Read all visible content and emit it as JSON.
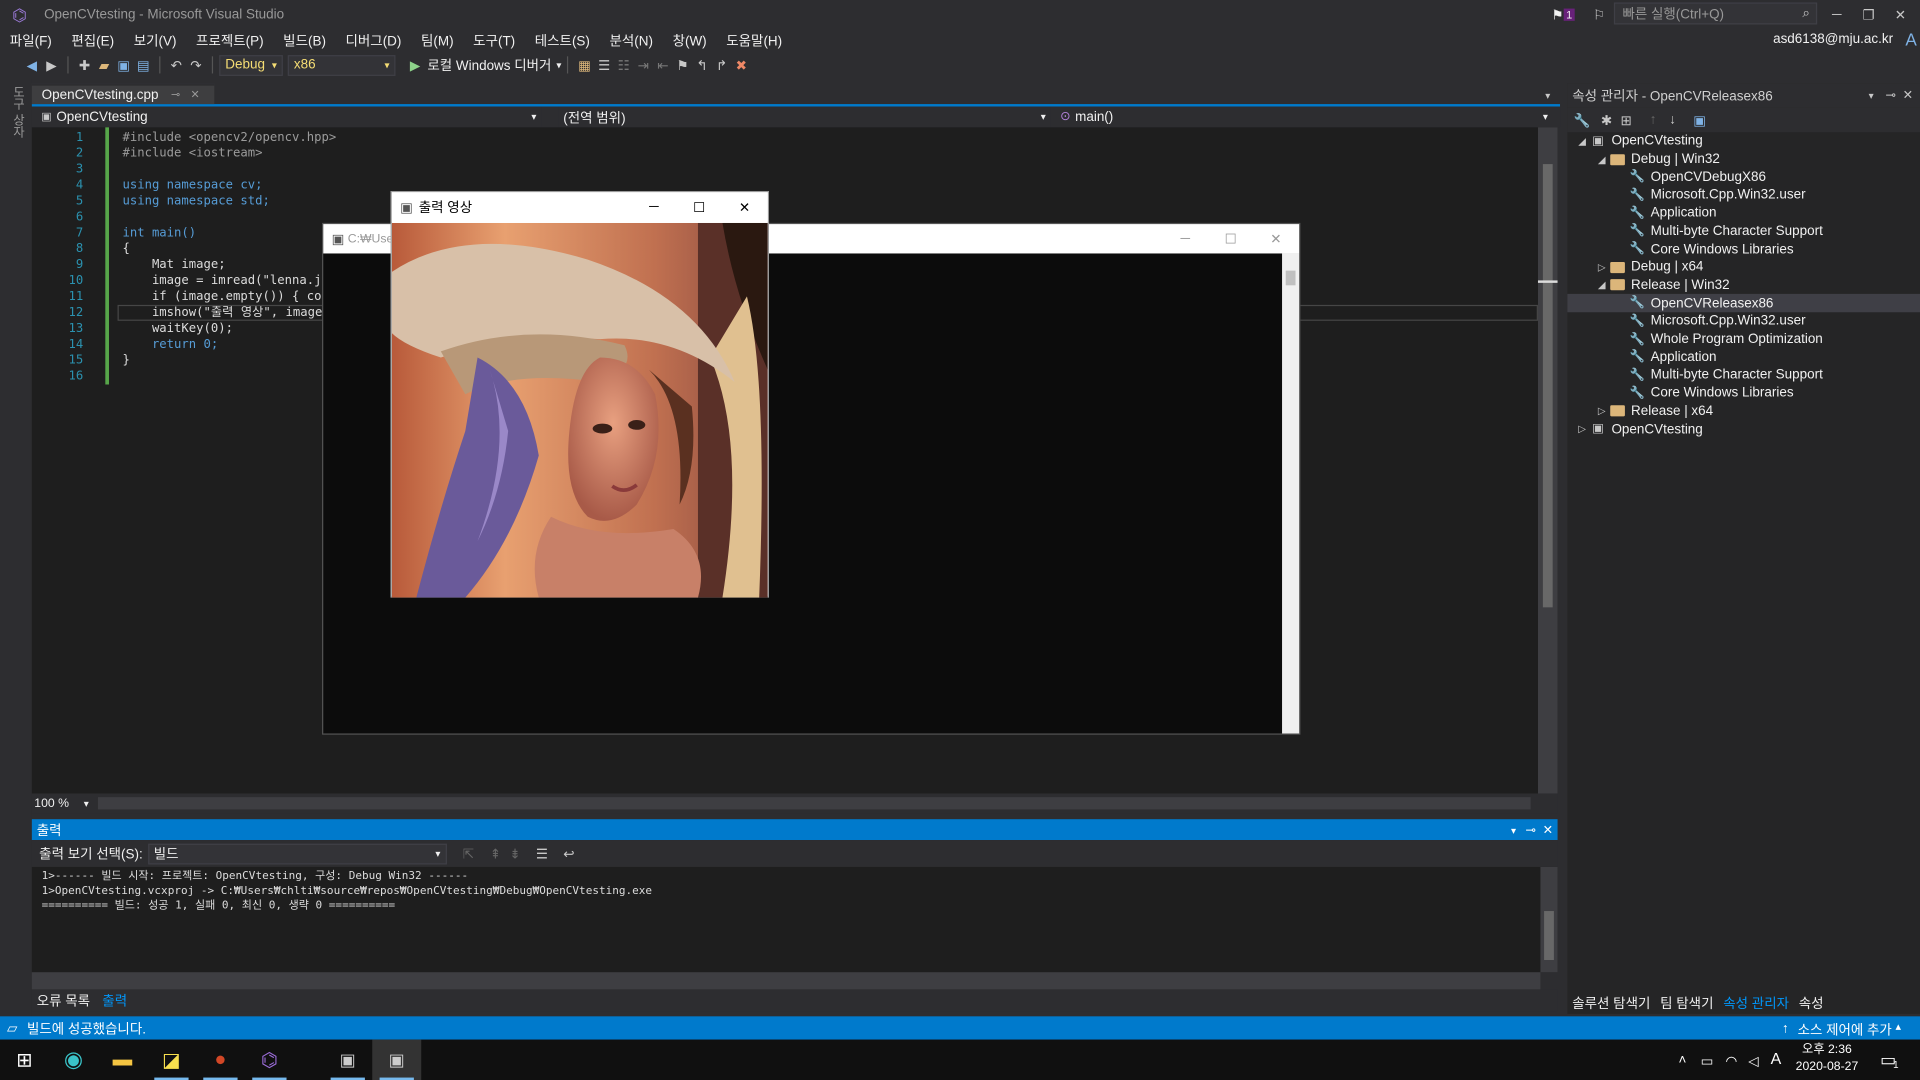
{
  "window_title": "OpenCVtesting - Microsoft Visual Studio",
  "search_placeholder": "빠른 실행(Ctrl+Q)",
  "notification_count": "1",
  "account": "asd6138@mju.ac.kr",
  "account_initial": "A",
  "menu": [
    "파일(F)",
    "편집(E)",
    "보기(V)",
    "프로젝트(P)",
    "빌드(B)",
    "디버그(D)",
    "팀(M)",
    "도구(T)",
    "테스트(S)",
    "분석(N)",
    "창(W)",
    "도움말(H)"
  ],
  "toolbar": {
    "config": "Debug",
    "platform": "x86",
    "debugger": "로컬 Windows 디버거"
  },
  "left_strip_label": "도구 상자",
  "doc_tab": "OpenCVtesting.cpp",
  "nav": {
    "project": "OpenCVtesting",
    "scope": "(전역 범위)",
    "member": "main()"
  },
  "code_lines": [
    "#include <opencv2/opencv.hpp>",
    "#include <iostream>",
    "",
    "using namespace cv;",
    "using namespace std;",
    "",
    "int main()",
    "{",
    "    Mat image;",
    "    image = imread(\"lenna.jpg",
    "    if (image.empty()) { cout",
    "    imshow(\"출력 영상\", image",
    "    waitKey(0);",
    "    return 0;",
    "}",
    ""
  ],
  "zoom": "100 %",
  "output": {
    "title": "출력",
    "source_label": "출력 보기 선택(S):",
    "source_value": "빌드",
    "lines": [
      "1>------ 빌드 시작: 프로젝트: OpenCVtesting, 구성: Debug Win32 ------",
      "1>OpenCVtesting.vcxproj -> C:₩Users₩chlti₩source₩repos₩OpenCVtesting₩Debug₩OpenCVtesting.exe",
      "========== 빌드: 성공 1, 실패 0, 최신 0, 생략 0 =========="
    ],
    "tabs": [
      "오류 목록",
      "출력"
    ]
  },
  "property_manager": {
    "title": "속성 관리자 - OpenCVReleasex86",
    "tree": [
      {
        "label": "OpenCVtesting",
        "level": 0,
        "kind": "project",
        "expanded": true
      },
      {
        "label": "Debug | Win32",
        "level": 1,
        "kind": "folder",
        "expanded": true
      },
      {
        "label": "OpenCVDebugX86",
        "level": 2,
        "kind": "sheet"
      },
      {
        "label": "Microsoft.Cpp.Win32.user",
        "level": 2,
        "kind": "sheet"
      },
      {
        "label": "Application",
        "level": 2,
        "kind": "sheet"
      },
      {
        "label": "Multi-byte Character Support",
        "level": 2,
        "kind": "sheet"
      },
      {
        "label": "Core Windows Libraries",
        "level": 2,
        "kind": "sheet"
      },
      {
        "label": "Debug | x64",
        "level": 1,
        "kind": "folder",
        "expanded": false
      },
      {
        "label": "Release | Win32",
        "level": 1,
        "kind": "folder",
        "expanded": true
      },
      {
        "label": "OpenCVReleasex86",
        "level": 2,
        "kind": "sheet",
        "selected": true
      },
      {
        "label": "Microsoft.Cpp.Win32.user",
        "level": 2,
        "kind": "sheet"
      },
      {
        "label": "Whole Program Optimization",
        "level": 2,
        "kind": "sheet"
      },
      {
        "label": "Application",
        "level": 2,
        "kind": "sheet"
      },
      {
        "label": "Multi-byte Character Support",
        "level": 2,
        "kind": "sheet"
      },
      {
        "label": "Core Windows Libraries",
        "level": 2,
        "kind": "sheet"
      },
      {
        "label": "Release | x64",
        "level": 1,
        "kind": "folder",
        "expanded": false
      },
      {
        "label": "OpenCVtesting",
        "level": 0,
        "kind": "project",
        "expanded": false
      }
    ],
    "tabs": [
      "솔루션 탐색기",
      "팀 탐색기",
      "속성 관리자",
      "속성"
    ]
  },
  "status": {
    "message": "빌드에 성공했습니다.",
    "source_control": "소스 제어에 추가"
  },
  "console_title": "C:₩Use",
  "image_window_title": "출력 영상",
  "taskbar": {
    "time": "오후 2:36",
    "date": "2020-08-27",
    "ime": "A",
    "notif": "1"
  },
  "colors": {
    "accent": "#007acc",
    "background": "#2d2d30",
    "editor": "#1e1e1e"
  }
}
